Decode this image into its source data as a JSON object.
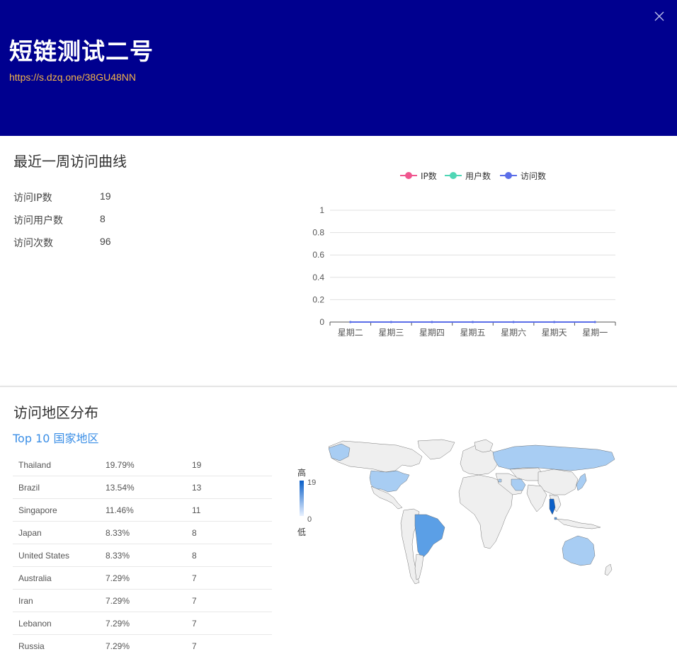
{
  "header": {
    "title": "短链测试二号",
    "short_url": "https://s.dzq.one/38GU48NN",
    "bg_color": "#00008f",
    "url_color": "#f2b44a"
  },
  "weekly": {
    "title": "最近一周访问曲线",
    "stats": [
      {
        "label": "访问IP数",
        "value": "19"
      },
      {
        "label": "访问用户数",
        "value": "8"
      },
      {
        "label": "访问次数",
        "value": "96"
      }
    ]
  },
  "chart_data": {
    "type": "line",
    "categories": [
      "星期二",
      "星期三",
      "星期四",
      "星期五",
      "星期六",
      "星期天",
      "星期一"
    ],
    "series": [
      {
        "name": "IP数",
        "values": [
          0,
          0,
          0,
          0,
          0,
          0,
          0
        ],
        "color": "#f0568f"
      },
      {
        "name": "用户数",
        "values": [
          0,
          0,
          0,
          0,
          0,
          0,
          0
        ],
        "color": "#4fd6b5"
      },
      {
        "name": "访问数",
        "values": [
          0,
          0,
          0,
          0,
          0,
          0,
          0
        ],
        "color": "#5b6ee8"
      }
    ],
    "ylim": [
      0,
      1
    ],
    "yticks": [
      "0",
      "0.2",
      "0.4",
      "0.6",
      "0.8",
      "1"
    ],
    "legend": "top",
    "grid": true
  },
  "region": {
    "title": "访问地区分布",
    "top10_label": "Top 10 国家地区",
    "rows": [
      {
        "country": "Thailand",
        "pct": "19.79%",
        "count": "19"
      },
      {
        "country": "Brazil",
        "pct": "13.54%",
        "count": "13"
      },
      {
        "country": "Singapore",
        "pct": "11.46%",
        "count": "11"
      },
      {
        "country": "Japan",
        "pct": "8.33%",
        "count": "8"
      },
      {
        "country": "United States",
        "pct": "8.33%",
        "count": "8"
      },
      {
        "country": "Australia",
        "pct": "7.29%",
        "count": "7"
      },
      {
        "country": "Iran",
        "pct": "7.29%",
        "count": "7"
      },
      {
        "country": "Lebanon",
        "pct": "7.29%",
        "count": "7"
      },
      {
        "country": "Russia",
        "pct": "7.29%",
        "count": "7"
      }
    ],
    "visual_map": {
      "high": "高",
      "low": "低",
      "max": "19",
      "min": "0"
    },
    "map_colors": {
      "high": "#0a5fc8",
      "mid": "#5b9fe6",
      "low": "#a8cdf3",
      "none": "#efefef"
    }
  }
}
